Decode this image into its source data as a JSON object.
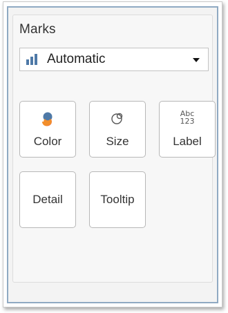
{
  "marks": {
    "title": "Marks",
    "mark_type": {
      "selected": "Automatic",
      "icon": "bar-chart-icon"
    },
    "buttons": [
      {
        "label": "Color",
        "icon": "color-icon"
      },
      {
        "label": "Size",
        "icon": "size-icon"
      },
      {
        "label": "Label",
        "icon": "abc-123-icon",
        "icon_text_top": "Abc",
        "icon_text_bottom": "123"
      },
      {
        "label": "Detail"
      },
      {
        "label": "Tooltip"
      }
    ]
  },
  "colors": {
    "frame_border": "#8fa9c2",
    "bar_icon": "#4e79a7",
    "color_icon_blue": "#4e79a7",
    "color_icon_orange": "#f28e2b"
  }
}
